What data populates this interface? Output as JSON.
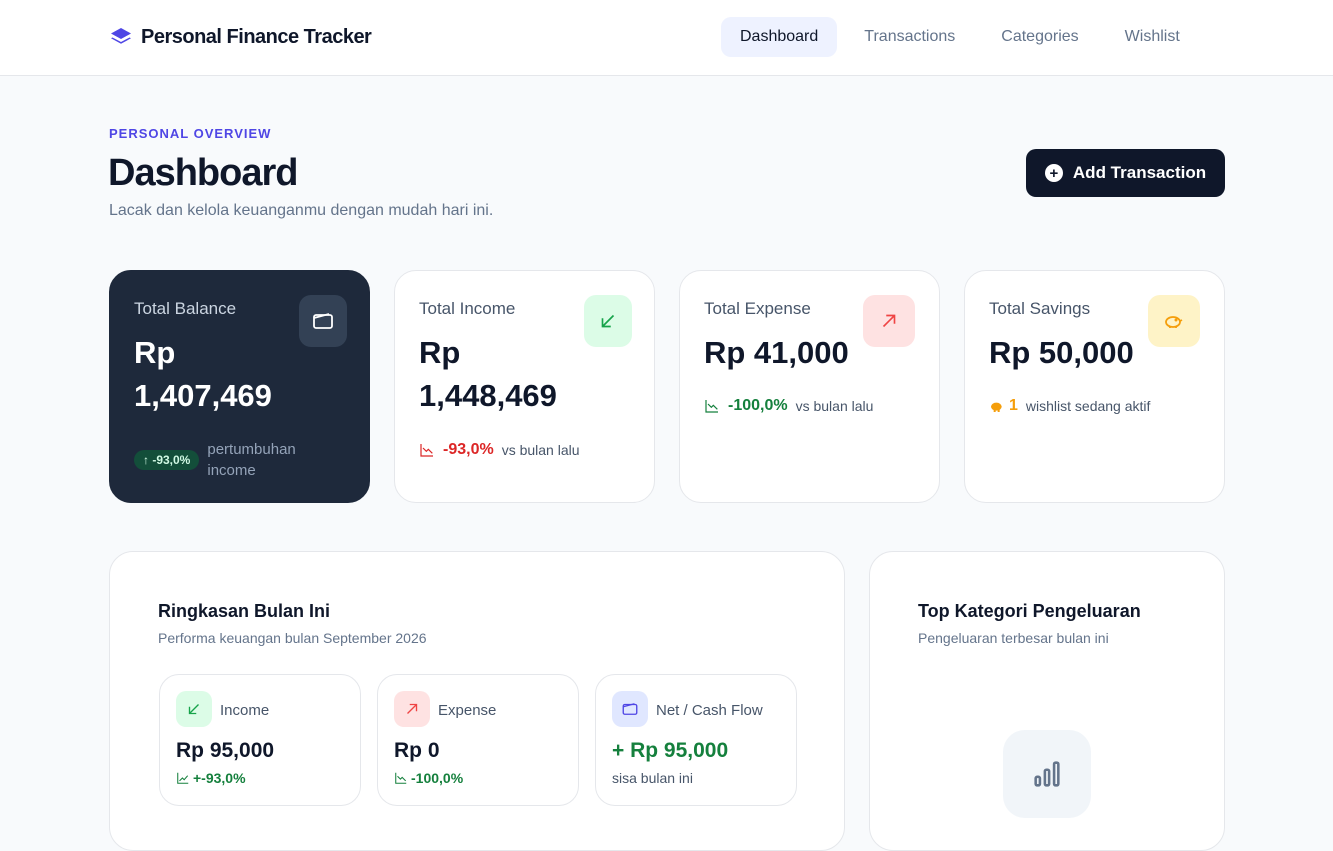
{
  "app": {
    "title": "Personal Finance Tracker"
  },
  "nav": [
    {
      "label": "Dashboard",
      "active": true
    },
    {
      "label": "Transactions",
      "active": false
    },
    {
      "label": "Categories",
      "active": false
    },
    {
      "label": "Wishlist",
      "active": false
    }
  ],
  "header": {
    "eyebrow": "PERSONAL OVERVIEW",
    "title": "Dashboard",
    "subtitle": "Lacak dan kelola keuanganmu dengan mudah hari ini.",
    "add_button": "Add Transaction"
  },
  "cards": {
    "balance": {
      "label": "Total Balance",
      "value_line1": "Rp",
      "value_line2": "1,407,469",
      "badge": "↑ -93,0%",
      "foot_text_line1": "pertumbuhan",
      "foot_text_line2": "income"
    },
    "income": {
      "label": "Total Income",
      "value_line1": "Rp",
      "value_line2": "1,448,469",
      "change": "-93,0%",
      "foot_text": "vs bulan lalu"
    },
    "expense": {
      "label": "Total Expense",
      "value": "Rp 41,000",
      "change": "-100,0%",
      "foot_text": "vs bulan lalu"
    },
    "savings": {
      "label": "Total Savings",
      "value": "Rp 50,000",
      "count": "1",
      "foot_text": "wishlist sedang aktif"
    }
  },
  "summary": {
    "title": "Ringkasan Bulan Ini",
    "subtitle": "Performa keuangan bulan September 2026",
    "income": {
      "label": "Income",
      "value": "Rp 95,000",
      "change": "+-93,0%"
    },
    "expense": {
      "label": "Expense",
      "value": "Rp 0",
      "change": "-100,0%"
    },
    "net": {
      "label": "Net / Cash Flow",
      "value": "+ Rp 95,000",
      "foot_text": "sisa bulan ini"
    }
  },
  "top_categories": {
    "title": "Top Kategori Pengeluaran",
    "subtitle": "Pengeluaran terbesar bulan ini"
  },
  "colors": {
    "accent": "#4f46e5",
    "dark": "#0f172a",
    "green": "#15803d",
    "red": "#dc2626",
    "amber": "#f59e0b"
  }
}
